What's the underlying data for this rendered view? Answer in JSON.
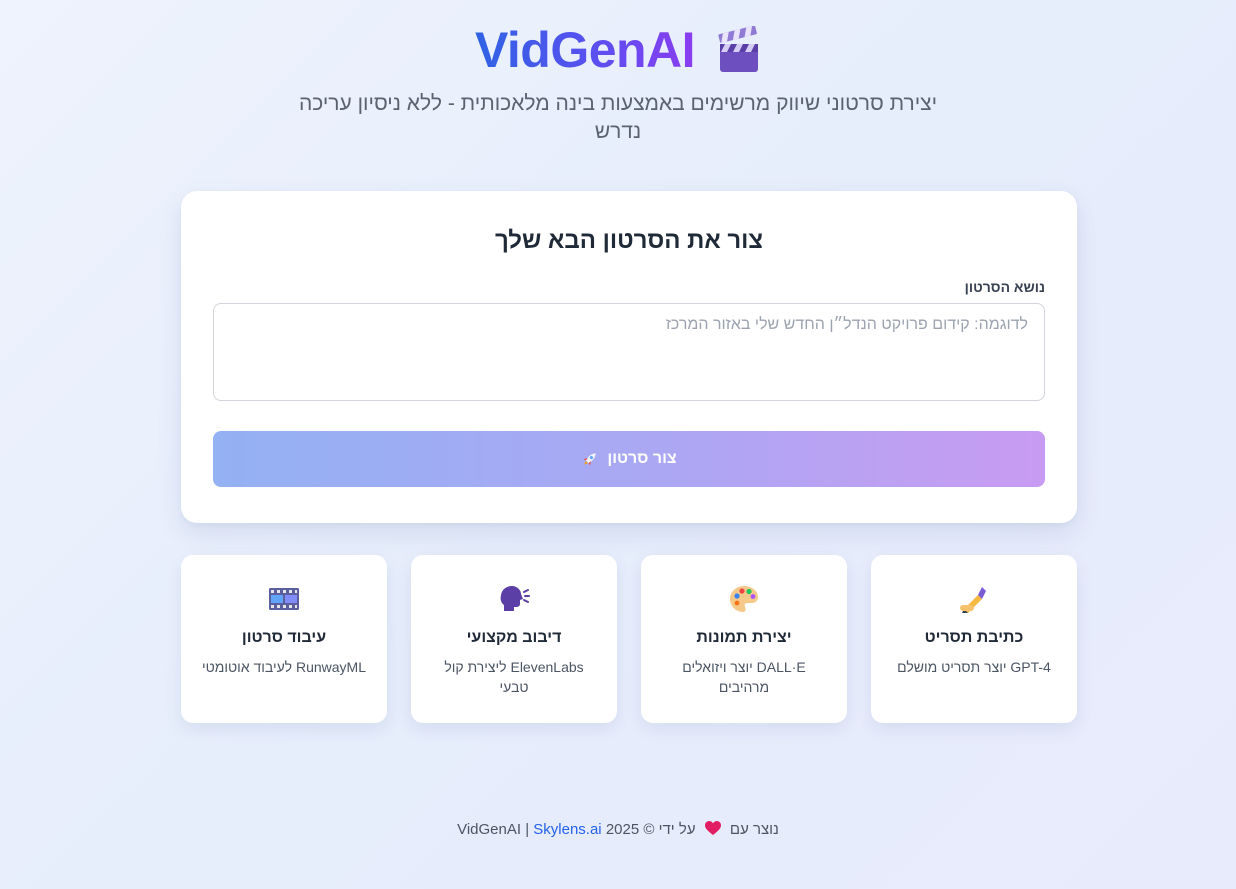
{
  "header": {
    "title": "VidGenAI",
    "subtitle": "יצירת סרטוני שיווק מרשימים באמצעות בינה מלאכותית - ללא ניסיון עריכה נדרש",
    "icon": "clapper-board-icon"
  },
  "form": {
    "title": "צור את הסרטון הבא שלך",
    "topic_label": "נושא הסרטון",
    "topic_placeholder": "לדוגמה: קידום פרויקט הנדל״ן החדש שלי באזור המרכז",
    "topic_value": "",
    "submit_label": "צור סרטון",
    "submit_icon": "rocket-icon"
  },
  "features": [
    {
      "icon": "writing-hand-icon",
      "title": "כתיבת תסריט",
      "description": "GPT-4 יוצר תסריט מושלם"
    },
    {
      "icon": "palette-icon",
      "title": "יצירת תמונות",
      "description": "DALL·E יוצר ויזואלים מרהיבים"
    },
    {
      "icon": "speaking-head-icon",
      "title": "דיבוב מקצועי",
      "description": "ElevenLabs ליצירת קול טבעי"
    },
    {
      "icon": "film-frames-icon",
      "title": "עיבוד סרטון",
      "description": "RunwayML לעיבוד אוטומטי"
    }
  ],
  "footer": {
    "made_with": "נוצר עם",
    "by": "על ידי",
    "copyright": "© 2025 VidGenAI |",
    "link_label": "Skylens.ai"
  },
  "colors": {
    "brand_start": "#2f63e4",
    "brand_end": "#8a3df0",
    "button_start": "#93b1f3",
    "button_end": "#c89bf2",
    "link": "#2563eb"
  }
}
